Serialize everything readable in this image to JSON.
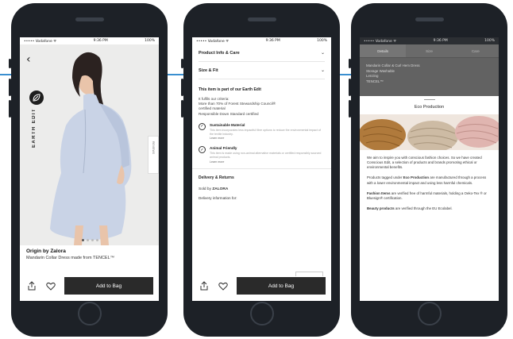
{
  "status": {
    "carrier": "••••• Vodafone ᯤ",
    "time": "9:36 PM",
    "battery": "100%"
  },
  "phone1": {
    "earth_edit_label": "EARTH EDIT",
    "reviews_label": "REVIEWS",
    "brand": "Origin by Zalora",
    "product_name": "Mandarin Collar Dress made from TENCEL™",
    "add_to_bag": "Add to Bag"
  },
  "phone2": {
    "accordion": [
      {
        "label": "Product Info & Care"
      },
      {
        "label": "Size & Fit"
      }
    ],
    "earth_edit_heading": "This item is part of our Earth Edit",
    "criteria": [
      "It fulfils our criteria:",
      "More than 70% of Forest Stewardship Council®",
      "certified material",
      "Responsible Down Standard certified"
    ],
    "features": [
      {
        "title": "Sustainable Material",
        "desc": "This item incorporates less impactful fibre options to reduce the environmental impact of the textile industry.",
        "link": "Learn more"
      },
      {
        "title": "Animal Friendly",
        "desc": "This item is made using non-animal alternative materials or certified responsibly sourced animal products.",
        "link": "Learn more"
      }
    ],
    "delivery_heading": "Delivery & Returns",
    "sold_by_prefix": "Sold by",
    "sold_by": "ZALORA",
    "delivery_info": "Delivery information for:",
    "add_to_bag": "Add to Bag"
  },
  "phone3": {
    "tabs": [
      "Details",
      "Size",
      "Care"
    ],
    "active_tab": 0,
    "list": [
      "Mandarin Collar & Curl Hem Dress",
      "Storage Washable",
      "Lenzing",
      "TENCEL™"
    ],
    "sheet_title": "Eco Production",
    "para1": "We aim to inspire you with conscious fashion choices. So we have created Conscious Edit, a selection of products and brands promoting ethical or environmental benefits.",
    "para2_pre": "Products tagged under",
    "para2_bold": "Eco Production",
    "para2_post": "are manufactured through a process with a lower environmental impact and using less harmful chemicals.",
    "para3_bold": "Fashion Items",
    "para3_post": "are verified free of harmful materials, holding a Oeko-Tex ® or Bluesign® certification.",
    "para4_bold": "Beauty products",
    "para4_post": "are verified through the EU Ecolabel."
  },
  "colors": {
    "accent_line": "#3a8fd0",
    "button": "#2a2a2a",
    "phone_body": "#1d2127"
  }
}
